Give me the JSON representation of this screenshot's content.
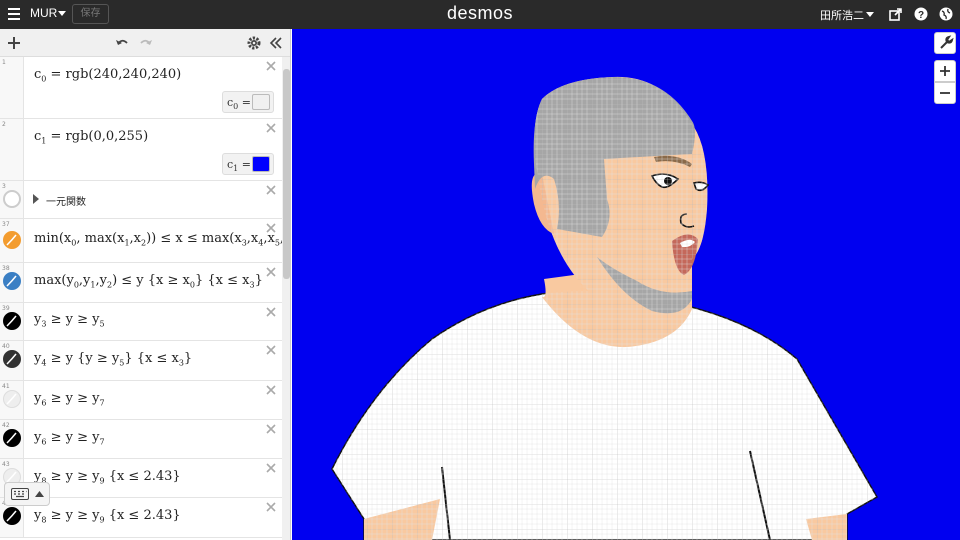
{
  "topbar": {
    "graph_title": "MUR",
    "save_label": "保存",
    "logo": "desmos",
    "user_name": "田所浩二"
  },
  "expressions": [
    {
      "num": "1",
      "latex_html": "c<sub>0</sub> = rgb(240,240,240)",
      "swatch_label": "c<sub>0</sub> =",
      "swatch_color": "#f0f0f0"
    },
    {
      "num": "2",
      "latex_html": "c<sub>1</sub> = rgb(0,0,255)",
      "swatch_label": "c<sub>1</sub> =",
      "swatch_color": "#0000ff"
    },
    {
      "num": "3",
      "folder_label": "一元関数"
    },
    {
      "num": "37",
      "latex_html": "min(x<sub>0</sub>, max(x<sub>1</sub>,x<sub>2</sub>)) ≤ x ≤ max(x<sub>3</sub>,x<sub>4</sub>,x<sub>5</sub>,x<sub>6</sub>",
      "icon_color": "#f39c2f"
    },
    {
      "num": "38",
      "latex_html": "max(y<sub>0</sub>,y<sub>1</sub>,y<sub>2</sub>) ≤ y {x ≥ x<sub>0</sub>} {x ≤ x<sub>3</sub>}",
      "icon_color": "#3b7fc4"
    },
    {
      "num": "39",
      "latex_html": "y<sub>3</sub> ≥ y ≥ y<sub>5</sub>",
      "icon_color": "#000000"
    },
    {
      "num": "40",
      "latex_html": "y<sub>4</sub> ≥ y {y ≥ y<sub>5</sub>} {x ≤ x<sub>3</sub>}",
      "icon_color": "#333333"
    },
    {
      "num": "41",
      "latex_html": "y<sub>6</sub> ≥ y ≥ y<sub>7</sub>",
      "icon_color": "#eeeeee"
    },
    {
      "num": "42",
      "latex_html": "y<sub>6</sub> ≥ y ≥ y<sub>7</sub>",
      "icon_color": "#000000"
    },
    {
      "num": "43",
      "latex_html": "y<sub>8</sub> ≥ y ≥ y<sub>9</sub> {x ≤ 2.43}",
      "icon_color": "#eeeeee"
    },
    {
      "num": "44",
      "latex_html": "y<sub>8</sub> ≥ y ≥ y<sub>9</sub> {x ≤ 2.43}",
      "icon_color": "#000000"
    }
  ],
  "colors": {
    "graph_background": "#0000f0",
    "skin": "#f9c9a0",
    "hair": "#a6a6a6",
    "shirt": "#ffffff"
  },
  "icons": [
    "menu-icon",
    "chevron-down-icon",
    "share-icon",
    "help-icon",
    "globe-icon",
    "plus-icon",
    "undo-icon",
    "redo-icon",
    "gear-icon",
    "collapse-icon",
    "close-icon",
    "wrench-icon",
    "zoom-in-icon",
    "zoom-out-icon",
    "keyboard-icon"
  ]
}
